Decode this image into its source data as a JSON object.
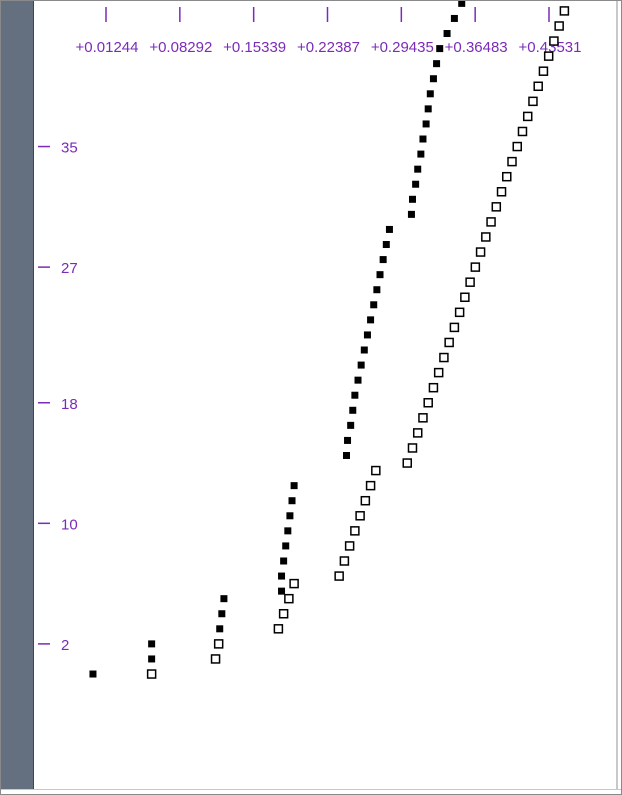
{
  "chart_data": {
    "type": "scatter",
    "title": "",
    "xlabel": "",
    "ylabel": "",
    "x_ticks": [
      "+0.01244",
      "+0.08292",
      "+0.15339",
      "+0.22387",
      "+0.29435",
      "+0.36483",
      "+0.43531"
    ],
    "x_tick_values": [
      0.01244,
      0.08292,
      0.15339,
      0.22387,
      0.29435,
      0.36483,
      0.43531
    ],
    "y_ticks": [
      "35",
      "27",
      "18",
      "10",
      "2"
    ],
    "y_tick_values": [
      35,
      27,
      18,
      10,
      2
    ],
    "xlim": [
      0.01244,
      0.43531
    ],
    "ylim": [
      -6.7,
      42.8
    ],
    "grid": false,
    "legend": "none",
    "colors": {
      "axis": "#7a2bb8",
      "marker": "#000000",
      "sidebar": "#647080"
    },
    "series": [
      {
        "marker": "filled-square",
        "points": [
          [
            0.0,
            0.0
          ],
          [
            0.056,
            1.0
          ],
          [
            0.056,
            2.0
          ],
          [
            0.118,
            1.0
          ],
          [
            0.12,
            2.0
          ],
          [
            0.121,
            3.0
          ],
          [
            0.123,
            4.0
          ],
          [
            0.125,
            5.0
          ],
          [
            0.18,
            5.5
          ],
          [
            0.18,
            6.5
          ],
          [
            0.182,
            7.5
          ],
          [
            0.184,
            8.5
          ],
          [
            0.186,
            9.5
          ],
          [
            0.188,
            10.5
          ],
          [
            0.19,
            11.5
          ],
          [
            0.192,
            12.5
          ],
          [
            0.242,
            14.5
          ],
          [
            0.243,
            15.5
          ],
          [
            0.246,
            16.5
          ],
          [
            0.248,
            17.5
          ],
          [
            0.25,
            18.5
          ],
          [
            0.253,
            19.5
          ],
          [
            0.256,
            20.5
          ],
          [
            0.259,
            21.5
          ],
          [
            0.262,
            22.5
          ],
          [
            0.265,
            23.5
          ],
          [
            0.268,
            24.5
          ],
          [
            0.271,
            25.5
          ],
          [
            0.274,
            26.5
          ],
          [
            0.277,
            27.5
          ],
          [
            0.28,
            28.5
          ],
          [
            0.283,
            29.5
          ],
          [
            0.304,
            30.5
          ],
          [
            0.305,
            31.5
          ],
          [
            0.308,
            32.5
          ],
          [
            0.31,
            33.5
          ],
          [
            0.313,
            34.5
          ],
          [
            0.315,
            35.5
          ],
          [
            0.318,
            36.5
          ],
          [
            0.32,
            37.5
          ],
          [
            0.322,
            38.5
          ],
          [
            0.325,
            39.5
          ],
          [
            0.328,
            40.5
          ],
          [
            0.331,
            41.5
          ],
          [
            0.338,
            42.5
          ],
          [
            0.345,
            43.5
          ],
          [
            0.352,
            44.5
          ]
        ]
      },
      {
        "marker": "hollow-square",
        "points": [
          [
            0.056,
            0.0
          ],
          [
            0.117,
            1.0
          ],
          [
            0.12,
            2.0
          ],
          [
            0.177,
            3.0
          ],
          [
            0.182,
            4.0
          ],
          [
            0.187,
            5.0
          ],
          [
            0.192,
            6.0
          ],
          [
            0.235,
            6.5
          ],
          [
            0.24,
            7.5
          ],
          [
            0.245,
            8.5
          ],
          [
            0.25,
            9.5
          ],
          [
            0.255,
            10.5
          ],
          [
            0.26,
            11.5
          ],
          [
            0.265,
            12.5
          ],
          [
            0.27,
            13.5
          ],
          [
            0.3,
            14.0
          ],
          [
            0.305,
            15.0
          ],
          [
            0.31,
            16.0
          ],
          [
            0.315,
            17.0
          ],
          [
            0.32,
            18.0
          ],
          [
            0.325,
            19.0
          ],
          [
            0.33,
            20.0
          ],
          [
            0.335,
            21.0
          ],
          [
            0.34,
            22.0
          ],
          [
            0.345,
            23.0
          ],
          [
            0.35,
            24.0
          ],
          [
            0.355,
            25.0
          ],
          [
            0.36,
            26.0
          ],
          [
            0.365,
            27.0
          ],
          [
            0.37,
            28.0
          ],
          [
            0.375,
            29.0
          ],
          [
            0.38,
            30.0
          ],
          [
            0.385,
            31.0
          ],
          [
            0.39,
            32.0
          ],
          [
            0.395,
            33.0
          ],
          [
            0.4,
            34.0
          ],
          [
            0.405,
            35.0
          ],
          [
            0.41,
            36.0
          ],
          [
            0.415,
            37.0
          ],
          [
            0.42,
            38.0
          ],
          [
            0.425,
            39.0
          ],
          [
            0.43,
            40.0
          ],
          [
            0.435,
            41.0
          ],
          [
            0.44,
            42.0
          ],
          [
            0.445,
            43.0
          ],
          [
            0.45,
            44.0
          ]
        ]
      }
    ]
  }
}
